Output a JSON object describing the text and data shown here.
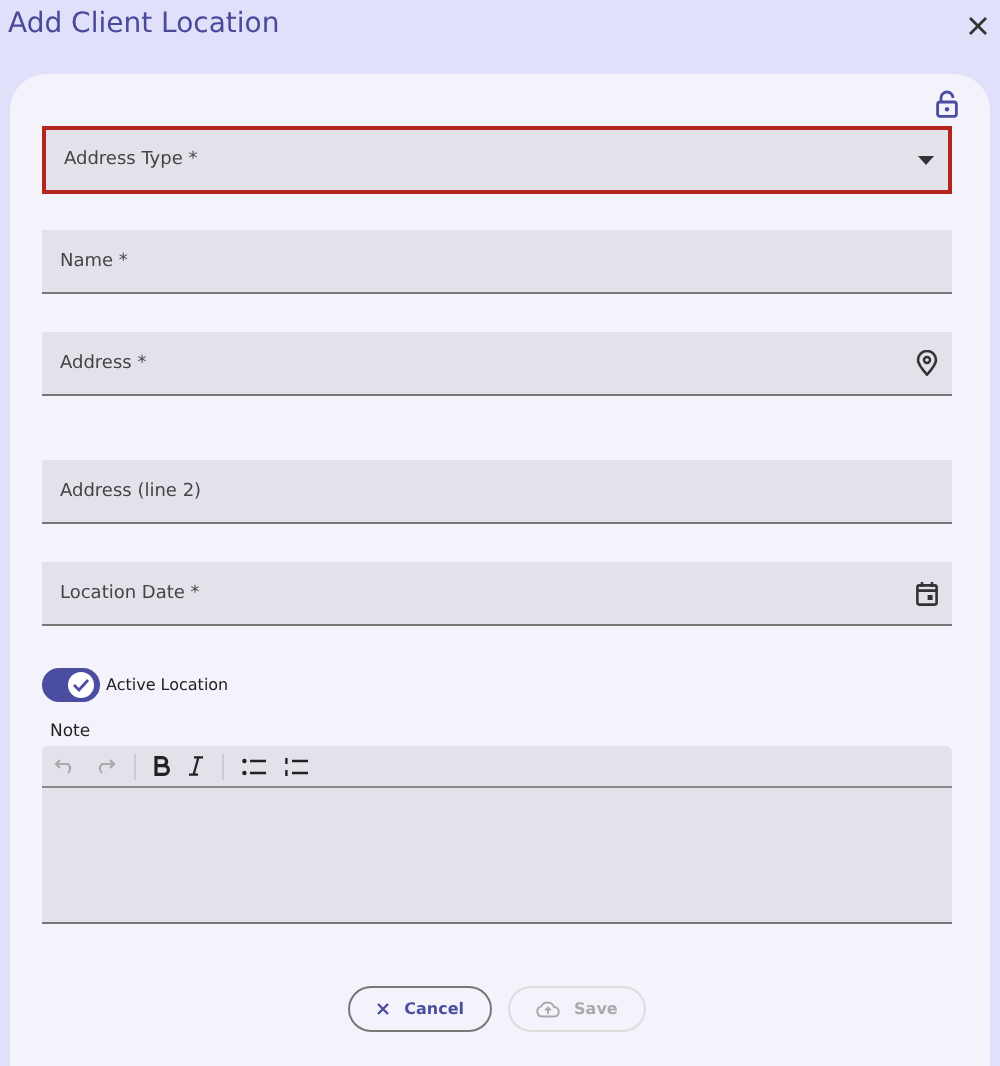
{
  "window": {
    "title": "Add Client Location"
  },
  "fields": [
    {
      "kind": "select",
      "label": "Address Type *",
      "invalid": true
    },
    {
      "kind": "text",
      "label": "Name *",
      "invalid": false
    },
    {
      "kind": "location",
      "label": "Address *",
      "invalid": false
    },
    {
      "kind": "text",
      "label": "Address (line 2)",
      "invalid": false
    },
    {
      "kind": "date",
      "label": "Location Date *",
      "invalid": false
    }
  ],
  "toggle": {
    "label": "Active Location",
    "on": true
  },
  "note": {
    "label": "Note"
  },
  "buttons": [
    {
      "kind": "cancel",
      "label": "Cancel",
      "disabled": false
    },
    {
      "kind": "save",
      "label": "Save",
      "disabled": true
    }
  ]
}
